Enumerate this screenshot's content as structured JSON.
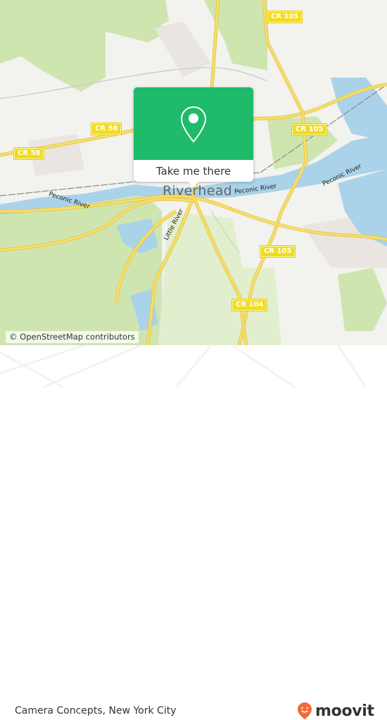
{
  "map": {
    "town_label": "Riverhead",
    "river_labels": [
      "Peconic River",
      "Peconic River",
      "Peconic River",
      "Little River"
    ],
    "road_shields": [
      "CR 105",
      "CR 58",
      "CR 58",
      "CR 105",
      "CR 105",
      "CR 104"
    ],
    "attribution": "© OpenStreetMap contributors",
    "colors": {
      "land": "#f2f2ee",
      "forest": "#cfe5b0",
      "water": "#aad3ea",
      "road": "#f7de6a",
      "urban": "#ebe5e2"
    }
  },
  "popup": {
    "icon": "map-pin-icon",
    "button_label": "Take me there",
    "color": "#1fba6a"
  },
  "footer": {
    "place_name": "Camera Concepts, New York City",
    "brand": "moovit",
    "brand_icon": "moovit-smile-pin-icon",
    "brand_color": "#f26b3a"
  }
}
